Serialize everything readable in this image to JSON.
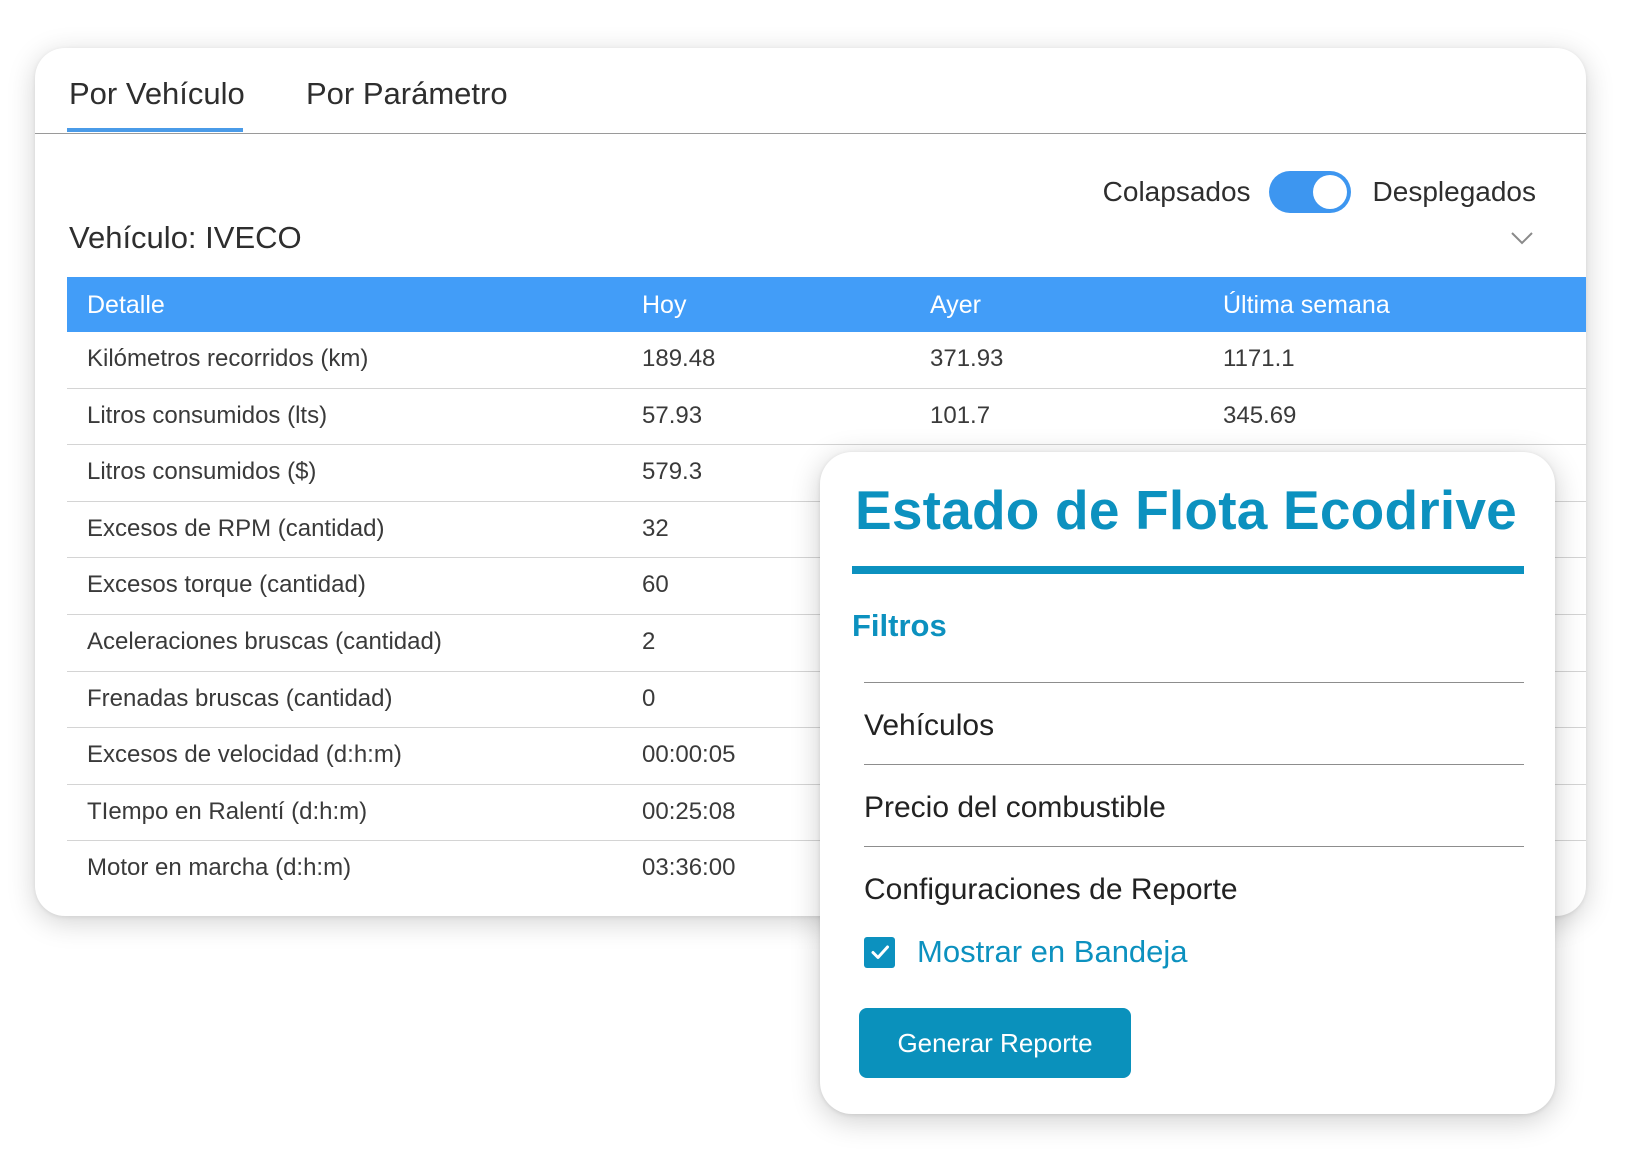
{
  "tabs": [
    {
      "label": "Por Vehículo",
      "active": true
    },
    {
      "label": "Por Parámetro",
      "active": false
    }
  ],
  "view_toggle": {
    "left_label": "Colapsados",
    "right_label": "Desplegados",
    "state": "on"
  },
  "vehicle": {
    "title": "Vehículo: IVECO"
  },
  "table": {
    "headers": [
      "Detalle",
      "Hoy",
      "Ayer",
      "Última semana"
    ],
    "rows": [
      [
        "Kilómetros recorridos (km)",
        "189.48",
        "371.93",
        "1171.1"
      ],
      [
        "Litros consumidos (lts)",
        "57.93",
        "101.7",
        "345.69"
      ],
      [
        "Litros consumidos ($)",
        "579.3",
        "",
        ""
      ],
      [
        "Excesos de RPM (cantidad)",
        "32",
        "",
        ""
      ],
      [
        "Excesos torque (cantidad)",
        "60",
        "",
        ""
      ],
      [
        "Aceleraciones bruscas (cantidad)",
        "2",
        "",
        ""
      ],
      [
        "Frenadas bruscas (cantidad)",
        "0",
        "",
        ""
      ],
      [
        "Excesos de velocidad (d:h:m)",
        "00:00:05",
        "",
        ""
      ],
      [
        "TIempo en Ralentí (d:h:m)",
        "00:25:08",
        "",
        ""
      ],
      [
        "Motor en marcha (d:h:m)",
        "03:36:00",
        "",
        ""
      ]
    ]
  },
  "panel": {
    "title": "Estado de Flota Ecodrive",
    "filters_title": "Filtros",
    "filters": [
      "Vehículos",
      "Precio del combustible",
      "Configuraciones de Reporte"
    ],
    "checkbox": {
      "label": "Mostrar en Bandeja",
      "checked": true
    },
    "button_label": "Generar Reporte"
  },
  "colors": {
    "tab_underline": "#4a9be8",
    "toggle": "#3d96f0",
    "table_header": "#429df8",
    "panel_accent": "#0c91bf"
  }
}
